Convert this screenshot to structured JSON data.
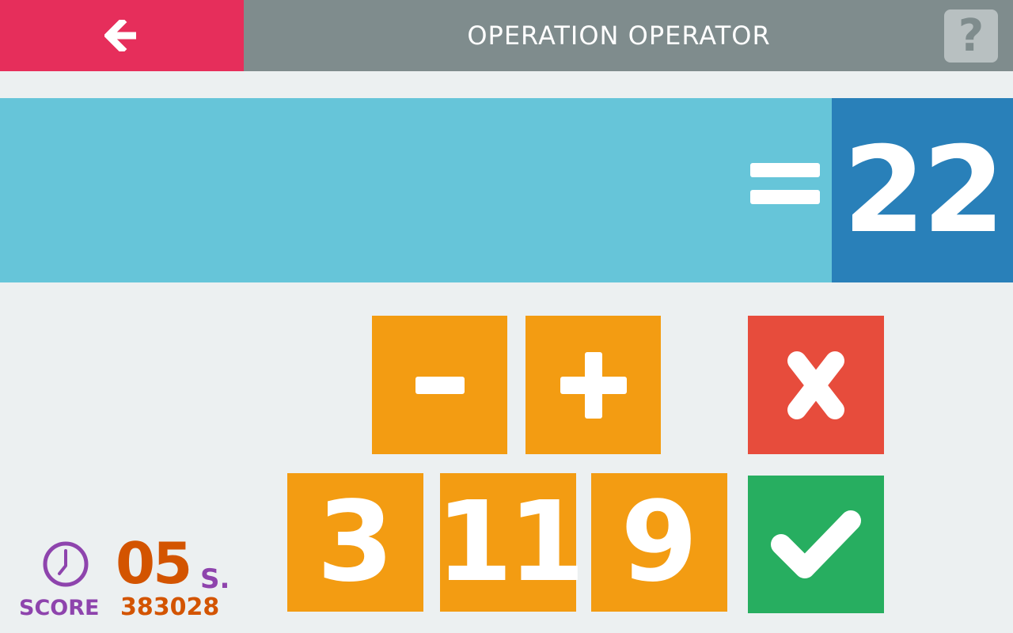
{
  "header": {
    "title": "OPERATION OPERATOR",
    "back_icon": "arrow-left-icon",
    "help_label": "?",
    "back_color": "#e62e5b",
    "bar_color": "#7f8c8d"
  },
  "equation": {
    "equals_icon": "equals-icon",
    "target": "22",
    "band_color": "#66c5d9",
    "target_color": "#2980b9"
  },
  "operators": [
    {
      "label": "−",
      "icon": "minus-icon"
    },
    {
      "label": "+",
      "icon": "plus-icon"
    }
  ],
  "numbers": [
    {
      "label": "3"
    },
    {
      "label": "11"
    },
    {
      "label": "9"
    }
  ],
  "actions": {
    "clear_icon": "x-icon",
    "clear_color": "#e74c3c",
    "submit_icon": "checkmark-icon",
    "submit_color": "#27ae60"
  },
  "timer": {
    "icon": "clock-icon",
    "value": "05",
    "unit": "S."
  },
  "score": {
    "label": "SCORE",
    "value": "383028"
  },
  "colors": {
    "tile": "#f39c12",
    "background": "#ecf0f1",
    "timer_text": "#d35400",
    "label_text": "#8e44ad"
  }
}
